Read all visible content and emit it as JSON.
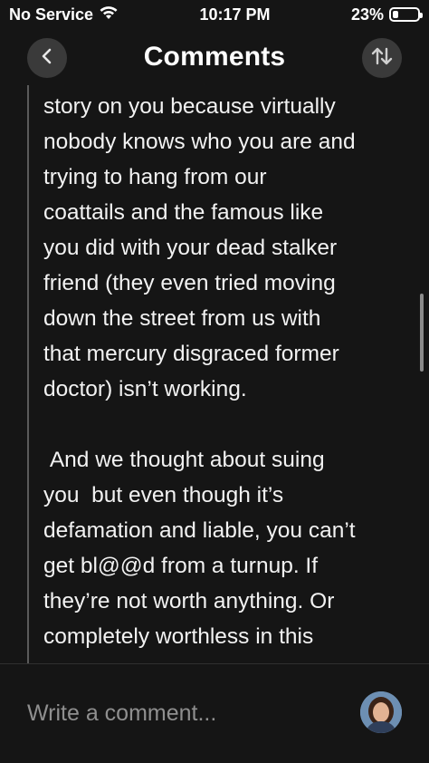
{
  "status_bar": {
    "carrier": "No Service",
    "time": "10:17 PM",
    "battery_percent": "23%",
    "battery_level": 0.23
  },
  "header": {
    "title": "Comments",
    "back_icon": "chevron-left-icon",
    "sort_icon": "sort-arrows-icon"
  },
  "comment": {
    "lines": [
      "story on you because virtually",
      "nobody knows who you are and",
      "trying to hang from our",
      "coattails and the famous like",
      "you did with your dead stalker",
      "friend (they even tried moving",
      "down the street from us with",
      "that mercury disgraced former",
      "doctor) isn’t working.",
      "",
      " And we thought about suing",
      "you  but even though it’s",
      "defamation and liable, you can’t",
      "get bl@@d from a turnup. If",
      "they’re not worth anything. Or",
      "completely worthless in this"
    ]
  },
  "composer": {
    "placeholder": "Write a comment..."
  },
  "colors": {
    "background": "#151515",
    "button_bg": "#3a3a3a",
    "thread_line": "#5a5a5a",
    "placeholder": "#8f8f8f"
  }
}
